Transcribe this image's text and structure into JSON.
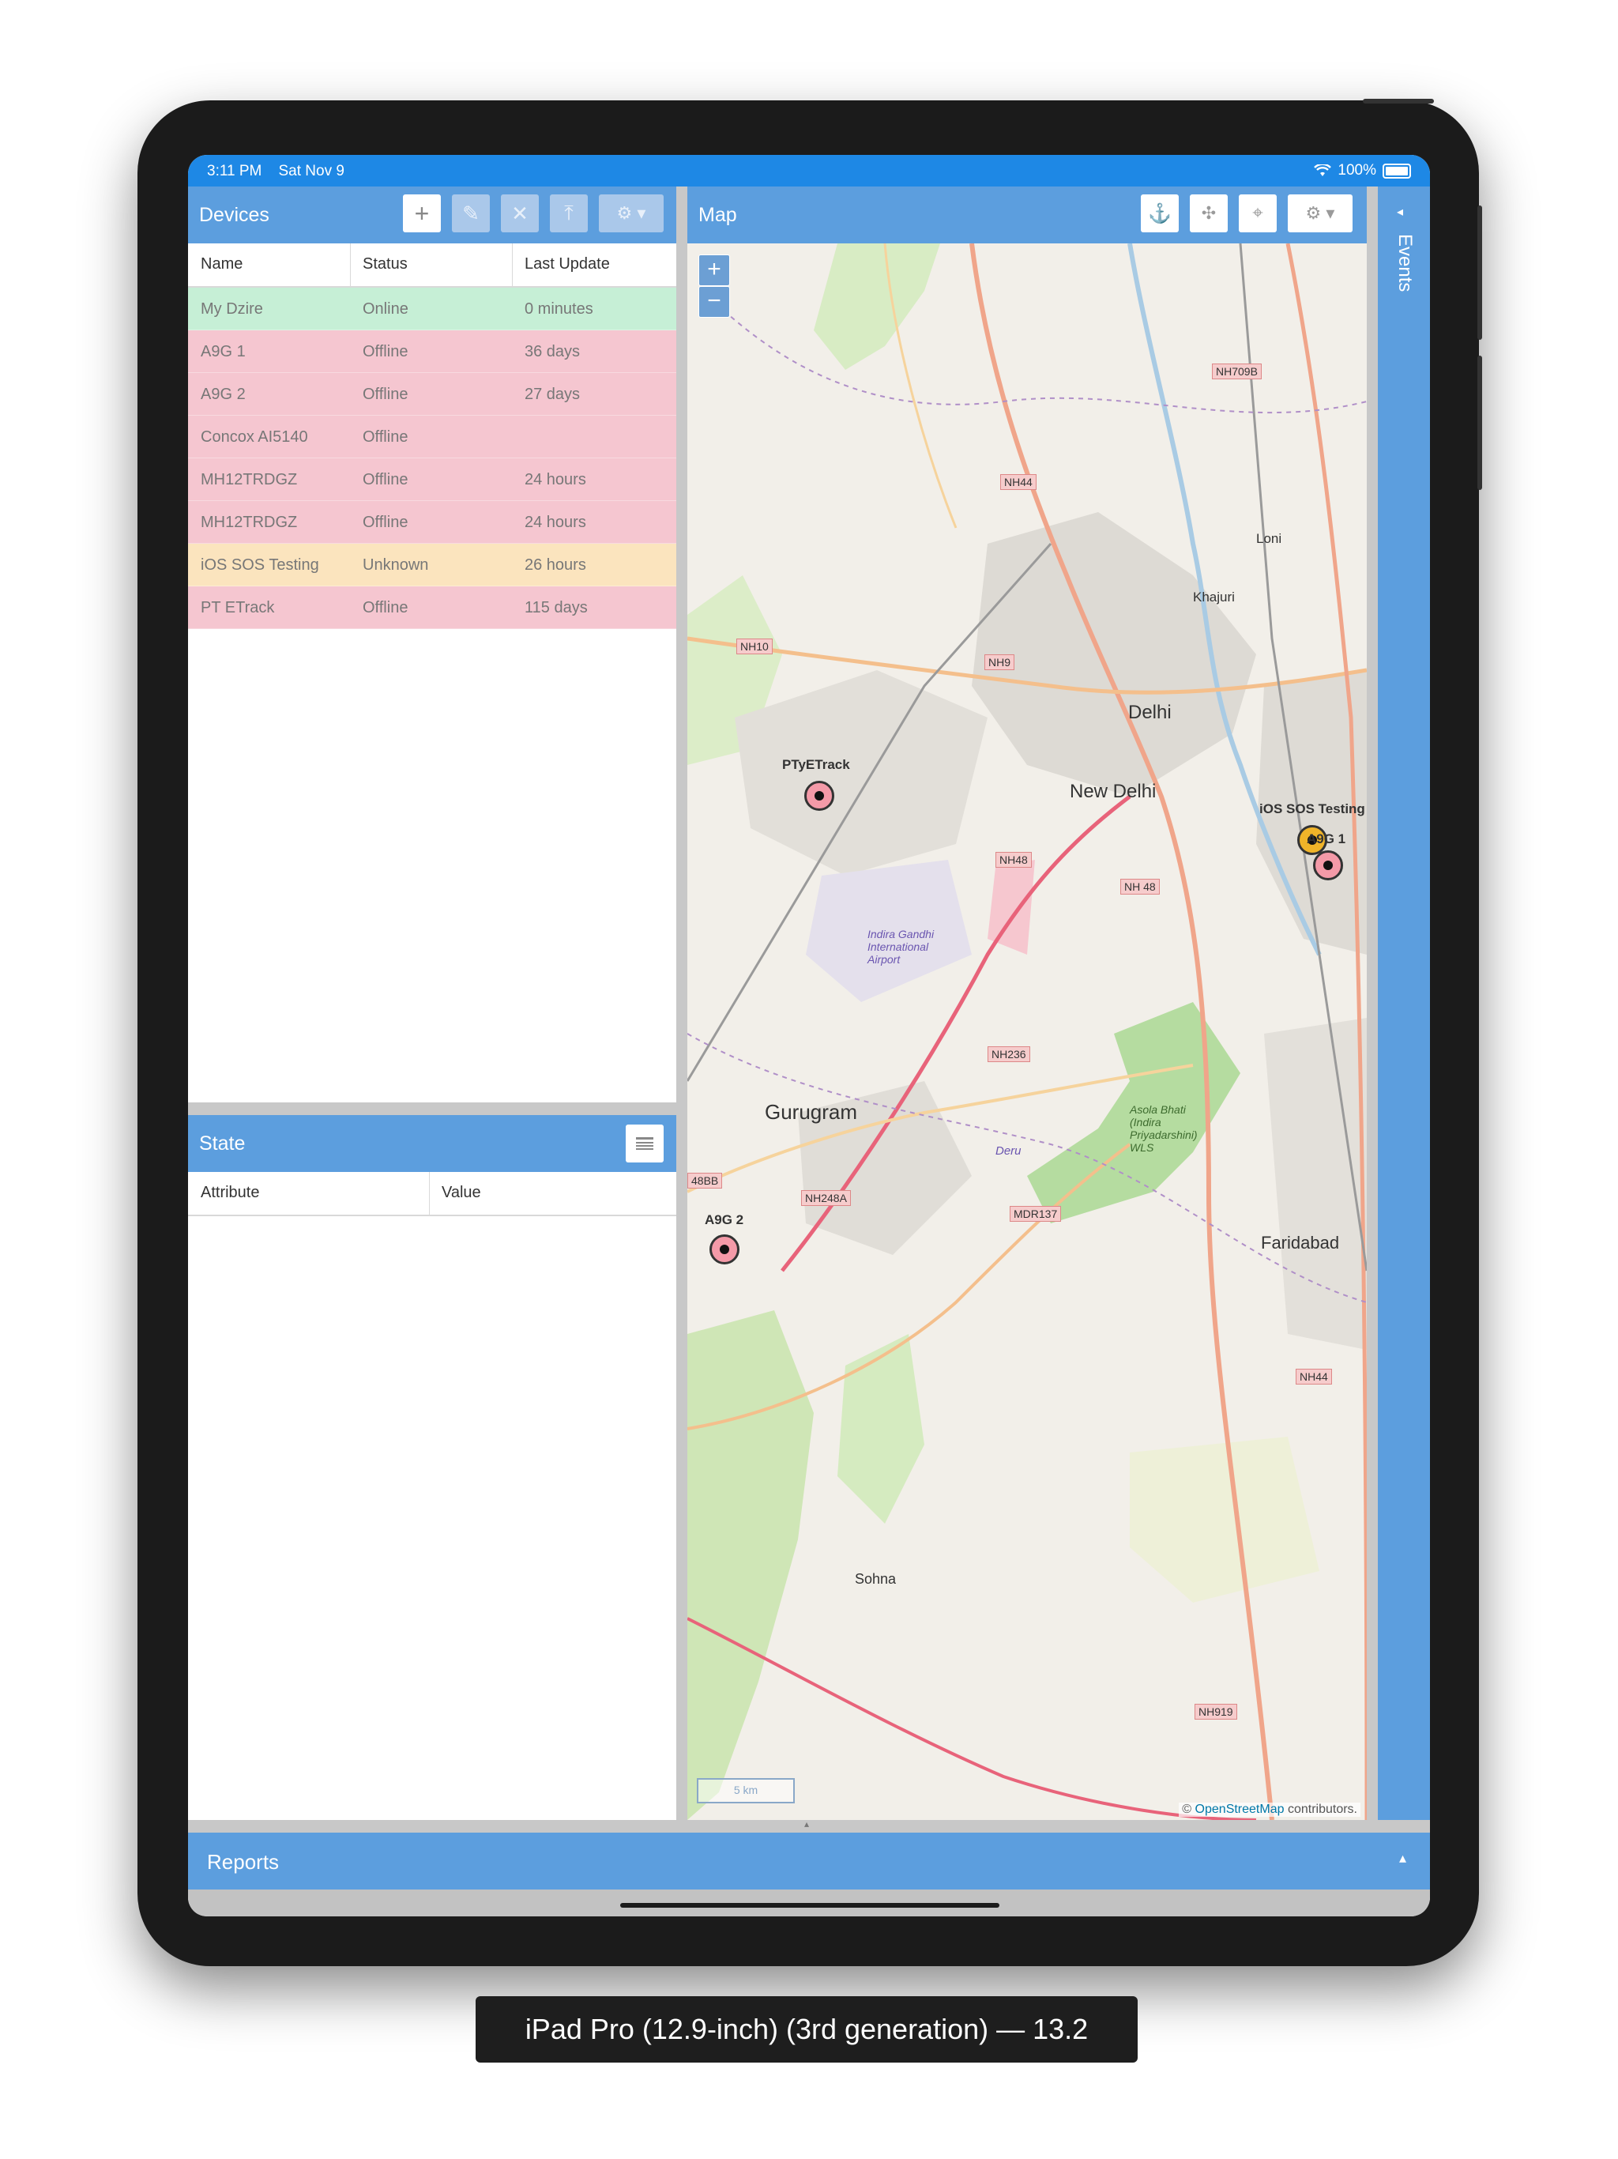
{
  "status_bar": {
    "time": "3:11 PM",
    "date": "Sat Nov 9",
    "battery": "100%",
    "wifi_icon": "wifi-icon",
    "battery_icon": "battery-icon"
  },
  "devices": {
    "title": "Devices",
    "toolbar_icons": [
      "add-icon",
      "edit-icon",
      "remove-icon",
      "upload-icon",
      "gear-icon"
    ],
    "columns": [
      "Name",
      "Status",
      "Last Update"
    ],
    "rows": [
      {
        "name": "My Dzire",
        "status": "Online",
        "last_update": "0 minutes",
        "state": "online"
      },
      {
        "name": "A9G 1",
        "status": "Offline",
        "last_update": "36 days",
        "state": "offline"
      },
      {
        "name": "A9G 2",
        "status": "Offline",
        "last_update": "27 days",
        "state": "offline"
      },
      {
        "name": "Concox AI5140",
        "status": "Offline",
        "last_update": "",
        "state": "offline"
      },
      {
        "name": "MH12TRDGZ",
        "status": "Offline",
        "last_update": "24 hours",
        "state": "offline"
      },
      {
        "name": "MH12TRDGZ",
        "status": "Offline",
        "last_update": "24 hours",
        "state": "offline"
      },
      {
        "name": "iOS SOS Testing",
        "status": "Unknown",
        "last_update": "26 hours",
        "state": "unknown"
      },
      {
        "name": "PT ETrack",
        "status": "Offline",
        "last_update": "115 days",
        "state": "offline"
      }
    ]
  },
  "state": {
    "title": "State",
    "columns": [
      "Attribute",
      "Value"
    ]
  },
  "map": {
    "title": "Map",
    "zoom_in": "+",
    "zoom_out": "−",
    "labels": {
      "delhi": "Delhi",
      "new_delhi": "New Delhi",
      "gurugram": "Gurugram",
      "faridabad": "Faridabad",
      "sohna": "Sohna",
      "loni": "Loni",
      "khajuri": "Khajuri",
      "airport": "Indira Gandhi International Airport",
      "sanctuary": "Asola Bhati (Indira Priyadarshini) WLS",
      "deru": "Deru"
    },
    "roads": [
      "NH709B",
      "NH44",
      "NH10",
      "NH9",
      "NH48",
      "NH 48",
      "NH236",
      "NH248A",
      "MDR137",
      "NH44",
      "NH919",
      "48BB"
    ],
    "markers": [
      {
        "label": "PTyETrack"
      },
      {
        "label": "iOS SOS Testing"
      },
      {
        "label": "A9G 1"
      },
      {
        "label": "A9G 2"
      }
    ],
    "scale": "5 km",
    "attribution_prefix": "©",
    "attribution_link": "OpenStreetMap",
    "attribution_suffix": "contributors."
  },
  "events": {
    "label": "Events"
  },
  "reports": {
    "label": "Reports"
  },
  "caption": "iPad Pro (12.9-inch) (3rd generation) — 13.2",
  "colors": {
    "header": "#5c9ede",
    "statusbar": "#1e88e5",
    "online": "#c6efd6",
    "offline": "#f5c6d0",
    "unknown": "#fbe4be",
    "marker_red": "#e85b6e",
    "marker_yellow": "#f0b429"
  }
}
